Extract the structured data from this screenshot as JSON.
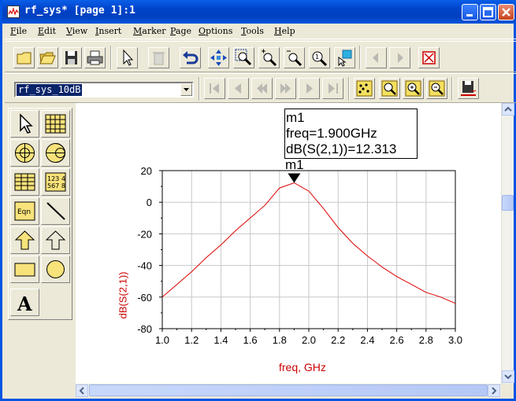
{
  "window": {
    "title": "rf_sys* [page 1]:1"
  },
  "menu": {
    "items": [
      "File",
      "Edit",
      "View",
      "Insert",
      "Marker",
      "Page",
      "Options",
      "Tools",
      "Help"
    ]
  },
  "toolbar": {
    "buttons": [
      "new-icon",
      "open-icon",
      "save-icon",
      "print-icon",
      "select-icon",
      "delete-icon",
      "undo-icon",
      "move-icon",
      "zoom-area-icon",
      "zoom-in-icon",
      "zoom-out-icon",
      "zoom-fit-icon",
      "pointer-icon",
      "previous-icon",
      "next-icon",
      "stop-icon"
    ]
  },
  "dataset": {
    "selected": "rf_sys_10dB"
  },
  "palette": {
    "items": [
      "pointer-icon",
      "table-icon",
      "polar-icon",
      "smith-icon",
      "list-icon",
      "stack-icon",
      "equation-icon",
      "line-icon",
      "polygon-icon",
      "polyline-icon",
      "rectangle-icon",
      "circle-icon",
      "text-icon"
    ],
    "list_text_a": "123 4",
    "list_text_b": "567 8",
    "eqn_text": "Eqn",
    "text_tool": "A"
  },
  "marker": {
    "name": "m1",
    "freq_line": "freq=1.900GHz",
    "value_line": "dB(S(2,1))=12.313",
    "label": "m1",
    "x": 1.9,
    "y": 12.313
  },
  "colors": {
    "trace": "#dd0000",
    "axis_label": "#cc0000",
    "grid": "#c8c8c8",
    "titlebar": "#0a5ee8"
  },
  "chart_data": {
    "type": "line",
    "xlabel": "freq, GHz",
    "ylabel": "dB(S(2,1))",
    "xlim": [
      1.0,
      3.0
    ],
    "ylim": [
      -80,
      20
    ],
    "x_ticks": [
      "1.0",
      "1.2",
      "1.4",
      "1.6",
      "1.8",
      "2.0",
      "2.2",
      "2.4",
      "2.6",
      "2.8",
      "3.0"
    ],
    "y_ticks": [
      "20",
      "0",
      "-20",
      "-40",
      "-60",
      "-80"
    ],
    "grid": true,
    "series": [
      {
        "x": [
          1.0,
          1.1,
          1.2,
          1.3,
          1.4,
          1.5,
          1.6,
          1.7,
          1.8,
          1.9,
          2.0,
          2.1,
          2.2,
          2.3,
          2.4,
          2.5,
          2.6,
          2.7,
          2.8,
          2.9,
          3.0
        ],
        "y": [
          -60,
          -52,
          -44,
          -35,
          -27,
          -18,
          -10,
          -2,
          9,
          12.3,
          7,
          -4,
          -16,
          -26,
          -34,
          -41,
          -47,
          -52,
          -57,
          -60,
          -64
        ]
      }
    ]
  }
}
